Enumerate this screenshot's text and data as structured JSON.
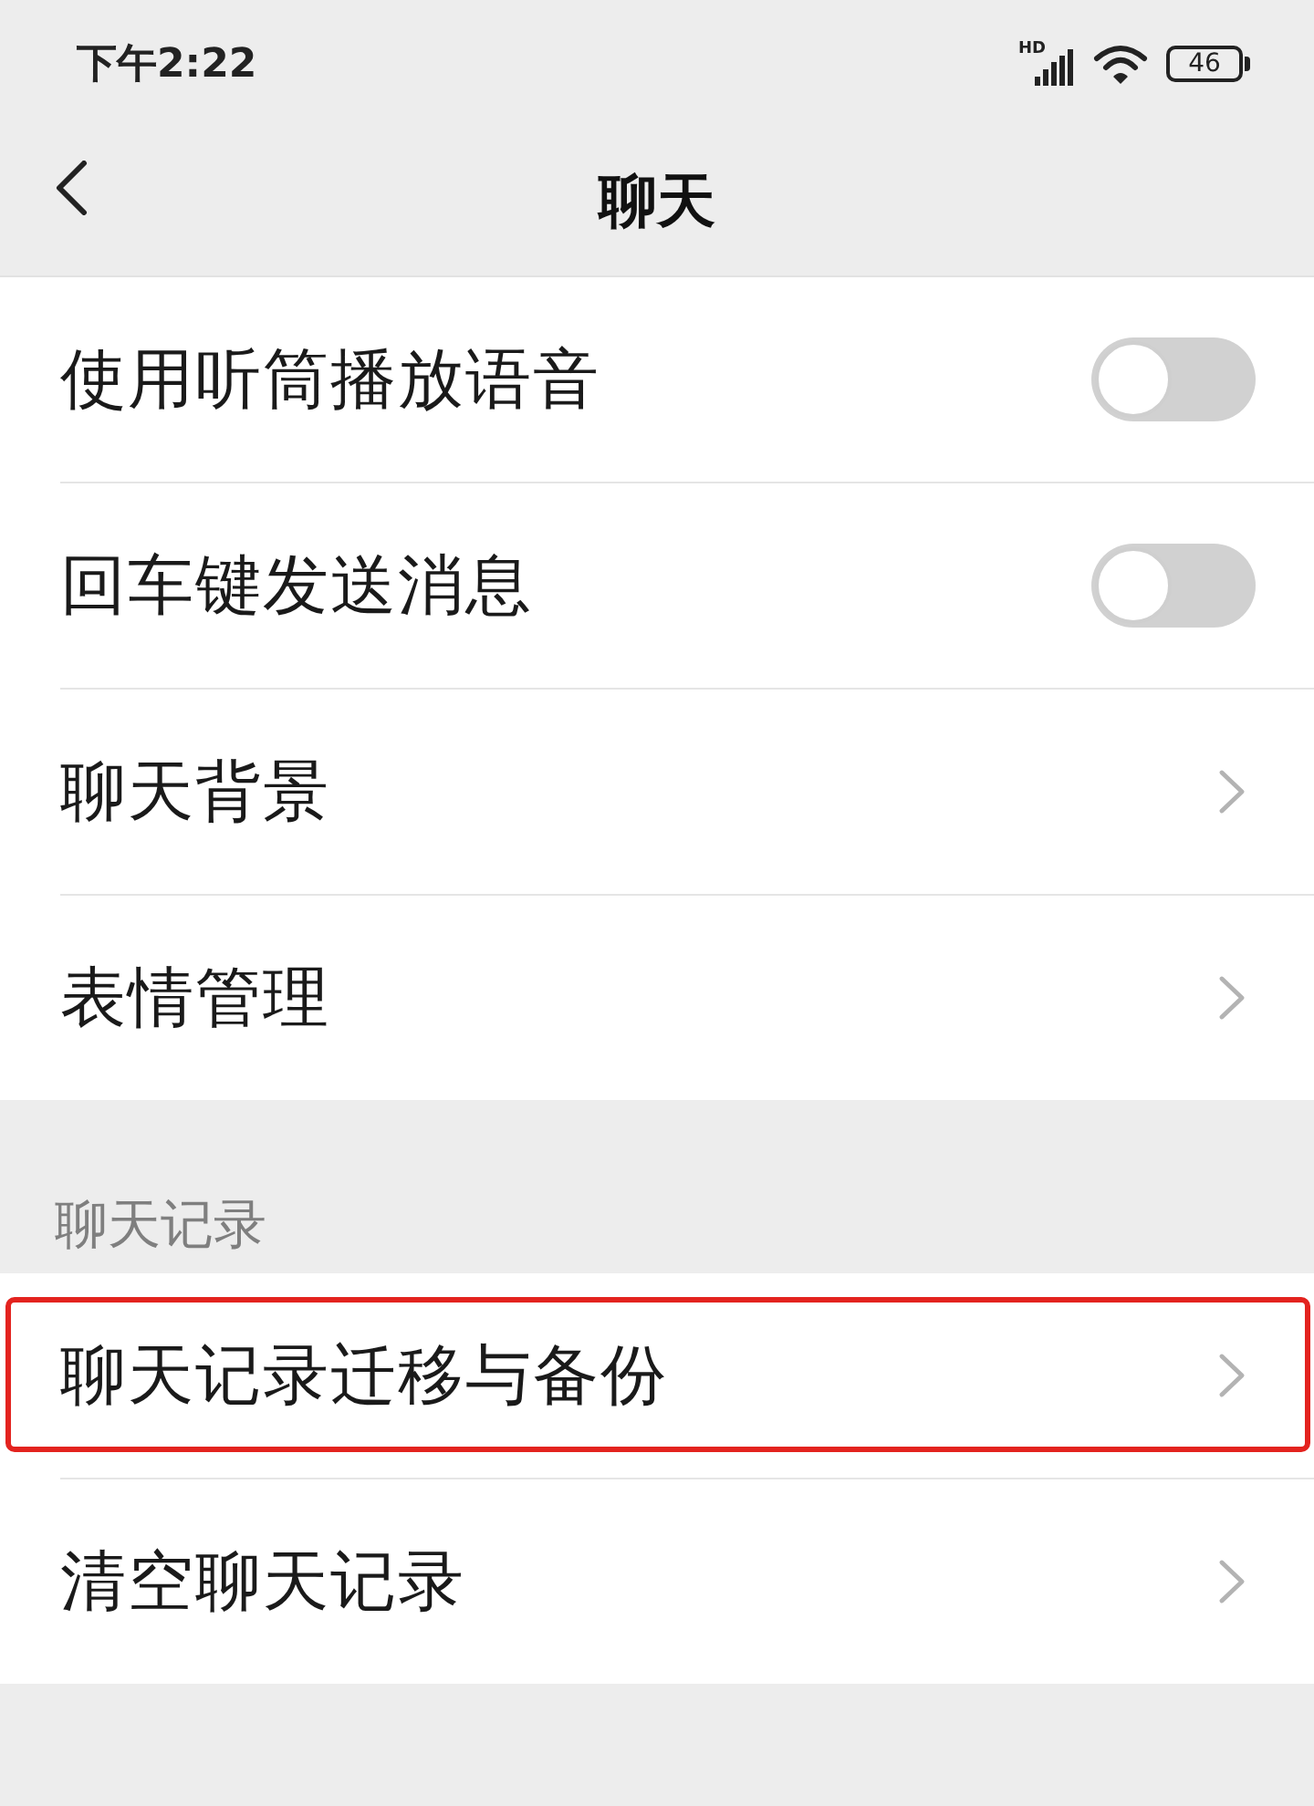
{
  "status_bar": {
    "time": "下午2:22",
    "network_label": "HD",
    "battery": "46"
  },
  "nav_bar": {
    "title": "聊天"
  },
  "sections": [
    {
      "items": [
        {
          "kind": "toggle",
          "label": "使用听筒播放语音",
          "on": false,
          "highlighted": false
        },
        {
          "kind": "toggle",
          "label": "回车键发送消息",
          "on": false,
          "highlighted": false
        },
        {
          "kind": "link",
          "label": "聊天背景",
          "highlighted": false
        },
        {
          "kind": "link",
          "label": "表情管理",
          "highlighted": false
        }
      ]
    },
    {
      "header": "聊天记录",
      "items": [
        {
          "kind": "link",
          "label": "聊天记录迁移与备份",
          "highlighted": true
        },
        {
          "kind": "link",
          "label": "清空聊天记录",
          "highlighted": false
        }
      ]
    }
  ]
}
